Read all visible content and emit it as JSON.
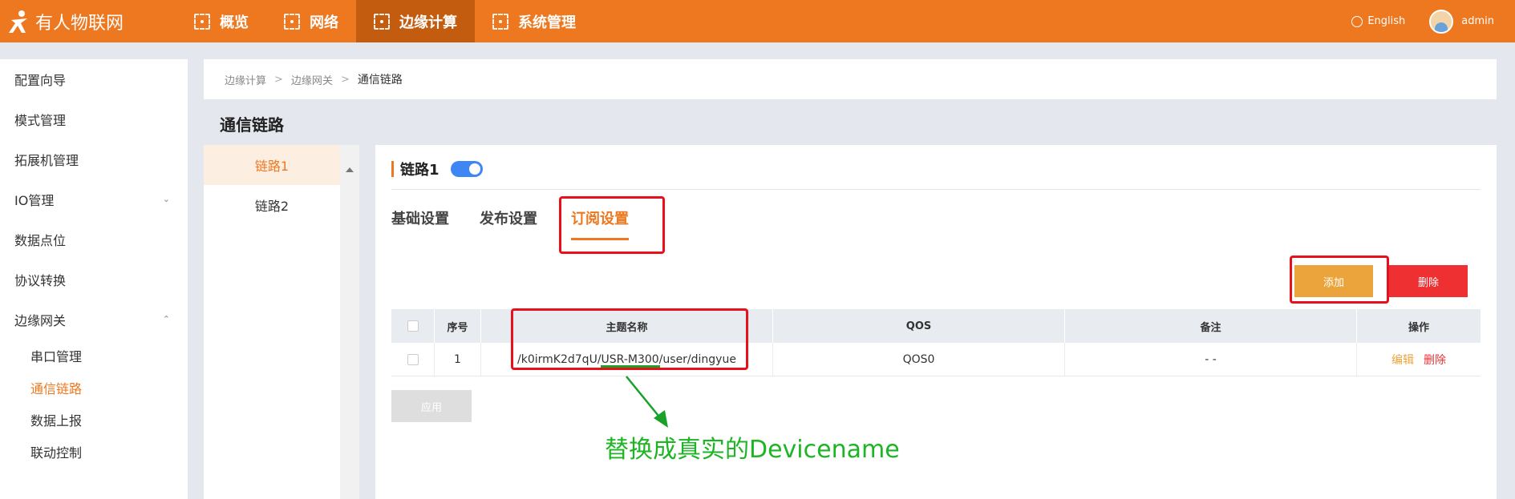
{
  "topbar": {
    "logo_text": "有人物联网",
    "nav": [
      {
        "label": "概览"
      },
      {
        "label": "网络"
      },
      {
        "label": "边缘计算"
      },
      {
        "label": "系统管理"
      }
    ],
    "language": "English",
    "user": "admin"
  },
  "sidebar": {
    "items": [
      {
        "label": "配置向导"
      },
      {
        "label": "模式管理"
      },
      {
        "label": "拓展机管理"
      },
      {
        "label": "IO管理"
      },
      {
        "label": "数据点位"
      },
      {
        "label": "协议转换"
      },
      {
        "label": "边缘网关"
      }
    ],
    "subitems": [
      {
        "label": "串口管理"
      },
      {
        "label": "通信链路"
      },
      {
        "label": "数据上报"
      },
      {
        "label": "联动控制"
      }
    ]
  },
  "breadcrumb": [
    "边缘计算",
    "边缘网关",
    "通信链路"
  ],
  "page_title": "通信链路",
  "links": [
    {
      "label": "链路1"
    },
    {
      "label": "链路2"
    }
  ],
  "panel": {
    "link_name": "链路1",
    "tabs": [
      {
        "label": "基础设置"
      },
      {
        "label": "发布设置"
      },
      {
        "label": "订阅设置"
      }
    ],
    "add_label": "添加",
    "delete_label": "删除",
    "apply_label": "应用"
  },
  "table": {
    "headers": [
      "序号",
      "主题名称",
      "QOS",
      "备注",
      "操作"
    ],
    "rows": [
      {
        "index": "1",
        "topic": "/k0irmK2d7qU/USR-M300/user/dingyue",
        "qos": "QOS0",
        "note": "- -",
        "edit": "编辑",
        "delete": "删除"
      }
    ]
  },
  "annotation": "替换成真实的Devicename",
  "colors": {
    "brand": "#ee781f",
    "highlight_box": "#e8101b",
    "annotation": "#1db524",
    "add_button": "#eba43b",
    "delete_button": "#ee3033"
  }
}
